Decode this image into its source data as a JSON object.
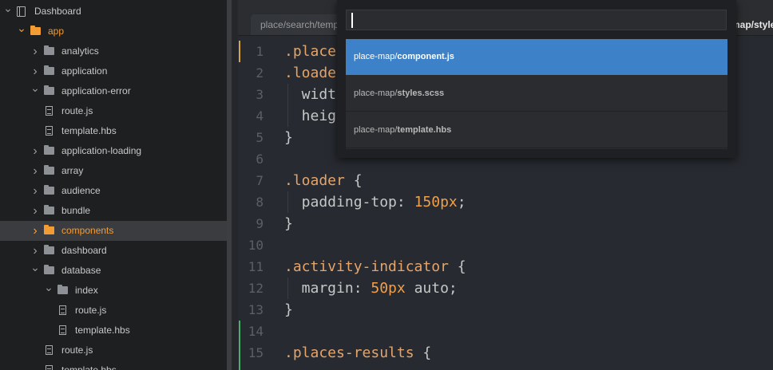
{
  "sidebar": {
    "rows": [
      {
        "label": "Dashboard",
        "type": "project",
        "expanded": true
      },
      {
        "label": "app",
        "type": "folder",
        "expanded": true,
        "highlight": "orange"
      },
      {
        "label": "analytics",
        "type": "folder",
        "expanded": false
      },
      {
        "label": "application",
        "type": "folder",
        "expanded": false
      },
      {
        "label": "application-error",
        "type": "folder",
        "expanded": true
      },
      {
        "label": "route.js",
        "type": "file"
      },
      {
        "label": "template.hbs",
        "type": "file"
      },
      {
        "label": "application-loading",
        "type": "folder",
        "expanded": false
      },
      {
        "label": "array",
        "type": "folder",
        "expanded": false
      },
      {
        "label": "audience",
        "type": "folder",
        "expanded": false
      },
      {
        "label": "bundle",
        "type": "folder",
        "expanded": false
      },
      {
        "label": "components",
        "type": "folder",
        "expanded": false,
        "selected": true,
        "highlight": "orange"
      },
      {
        "label": "dashboard",
        "type": "folder",
        "expanded": false
      },
      {
        "label": "database",
        "type": "folder",
        "expanded": true
      },
      {
        "label": "index",
        "type": "folder",
        "expanded": true
      },
      {
        "label": "route.js",
        "type": "file"
      },
      {
        "label": "template.hbs",
        "type": "file"
      },
      {
        "label": "route.js",
        "type": "file"
      },
      {
        "label": "template.hbs",
        "type": "file"
      }
    ]
  },
  "tabs": {
    "tab1": "place/search/template.hbs",
    "tab2": "map/styles.scss"
  },
  "editor": {
    "lines": [
      {
        "n": "1",
        "text": ".place"
      },
      {
        "n": "2",
        "text": ".loade"
      },
      {
        "n": "3",
        "text": "  widt"
      },
      {
        "n": "4",
        "text": "  heig"
      },
      {
        "n": "5",
        "text": "}"
      },
      {
        "n": "6",
        "text": ""
      },
      {
        "n": "7",
        "text": ".loader {"
      },
      {
        "n": "8",
        "text": "  padding-top: 150px;"
      },
      {
        "n": "9",
        "text": "}"
      },
      {
        "n": "10",
        "text": ""
      },
      {
        "n": "11",
        "text": ".activity-indicator {"
      },
      {
        "n": "12",
        "text": "  margin: 50px auto;"
      },
      {
        "n": "13",
        "text": "}"
      },
      {
        "n": "14",
        "text": ""
      },
      {
        "n": "15",
        "text": ".places-results {"
      }
    ]
  },
  "palette": {
    "query": "",
    "results": [
      {
        "path": "place-map/",
        "name": "component.js",
        "active": true
      },
      {
        "path": "place-map/",
        "name": "styles.scss",
        "active": false
      },
      {
        "path": "place-map/",
        "name": "template.hbs",
        "active": false
      }
    ]
  },
  "colors": {
    "accent_orange": "#f39c33",
    "selection_blue": "#3d82c9",
    "selector_color": "#e5a56a",
    "number_color": "#f0a04b"
  }
}
